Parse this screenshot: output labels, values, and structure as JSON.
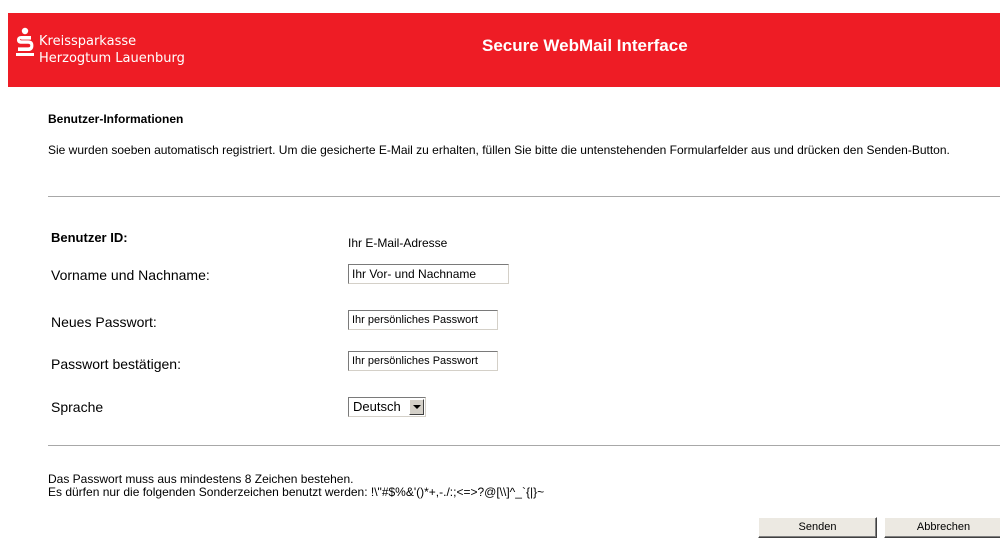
{
  "header": {
    "bank_name_line1": "Kreissparkasse",
    "bank_name_line2": "Herzogtum Lauenburg",
    "title": "Secure WebMail Interface",
    "brand_color": "#ee1c25",
    "logo_icon": "sparkasse-s-icon"
  },
  "section": {
    "title": "Benutzer-Informationen",
    "intro": "Sie wurden soeben automatisch registriert. Um die gesicherte E-Mail zu erhalten, füllen Sie bitte die untenstehenden Formularfelder aus und drücken den Senden-Button."
  },
  "form": {
    "user_id_label": "Benutzer ID:",
    "user_id_value": "Ihr E-Mail-Adresse",
    "name_label": "Vorname und Nachname:",
    "name_value": "Ihr Vor- und Nachname",
    "password_label": "Neues Passwort:",
    "password_value": "Ihr persönliches Passwort",
    "confirm_label": "Passwort bestätigen:",
    "confirm_value": "Ihr persönliches Passwort",
    "language_label": "Sprache",
    "language_value": "Deutsch"
  },
  "notes": {
    "line1": "Das Passwort muss aus mindestens 8 Zeichen bestehen.",
    "line2": "Es dürfen nur die folgenden Sonderzeichen benutzt werden: !\\\"#$%&'()*+,-./:;<=>?@[\\\\]^_`{|}~"
  },
  "buttons": {
    "send": "Senden",
    "cancel": "Abbrechen"
  }
}
